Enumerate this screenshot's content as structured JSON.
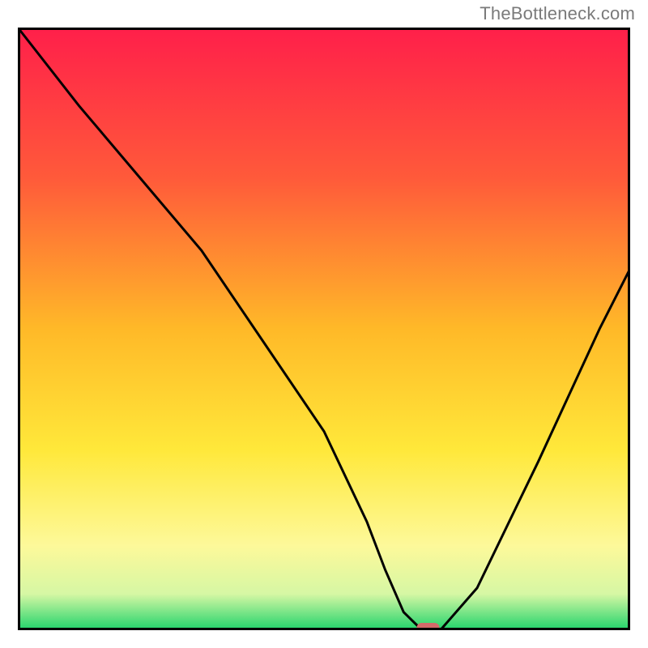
{
  "watermark": "TheBottleneck.com",
  "chart_data": {
    "type": "line",
    "title": "",
    "xlabel": "",
    "ylabel": "",
    "xlim": [
      0,
      100
    ],
    "ylim": [
      0,
      100
    ],
    "series": [
      {
        "name": "bottleneck-curve",
        "x": [
          0,
          10,
          20,
          30,
          40,
          50,
          57,
          60,
          63,
          66,
          69,
          75,
          85,
          95,
          100
        ],
        "values": [
          100,
          87,
          75,
          63,
          48,
          33,
          18,
          10,
          3,
          0,
          0,
          7,
          28,
          50,
          60
        ]
      }
    ],
    "annotations": [
      {
        "name": "target-marker",
        "x": 67,
        "y": 0
      }
    ],
    "gradient_stops": [
      {
        "offset": 0,
        "color": "#ff1f4a"
      },
      {
        "offset": 25,
        "color": "#ff5a3a"
      },
      {
        "offset": 50,
        "color": "#ffb928"
      },
      {
        "offset": 70,
        "color": "#ffe83a"
      },
      {
        "offset": 86,
        "color": "#fdf99a"
      },
      {
        "offset": 94,
        "color": "#d6f7a4"
      },
      {
        "offset": 100,
        "color": "#1fd36b"
      }
    ],
    "border_color": "#000000",
    "line_color": "#000000",
    "marker_color": "#d46a6a"
  }
}
